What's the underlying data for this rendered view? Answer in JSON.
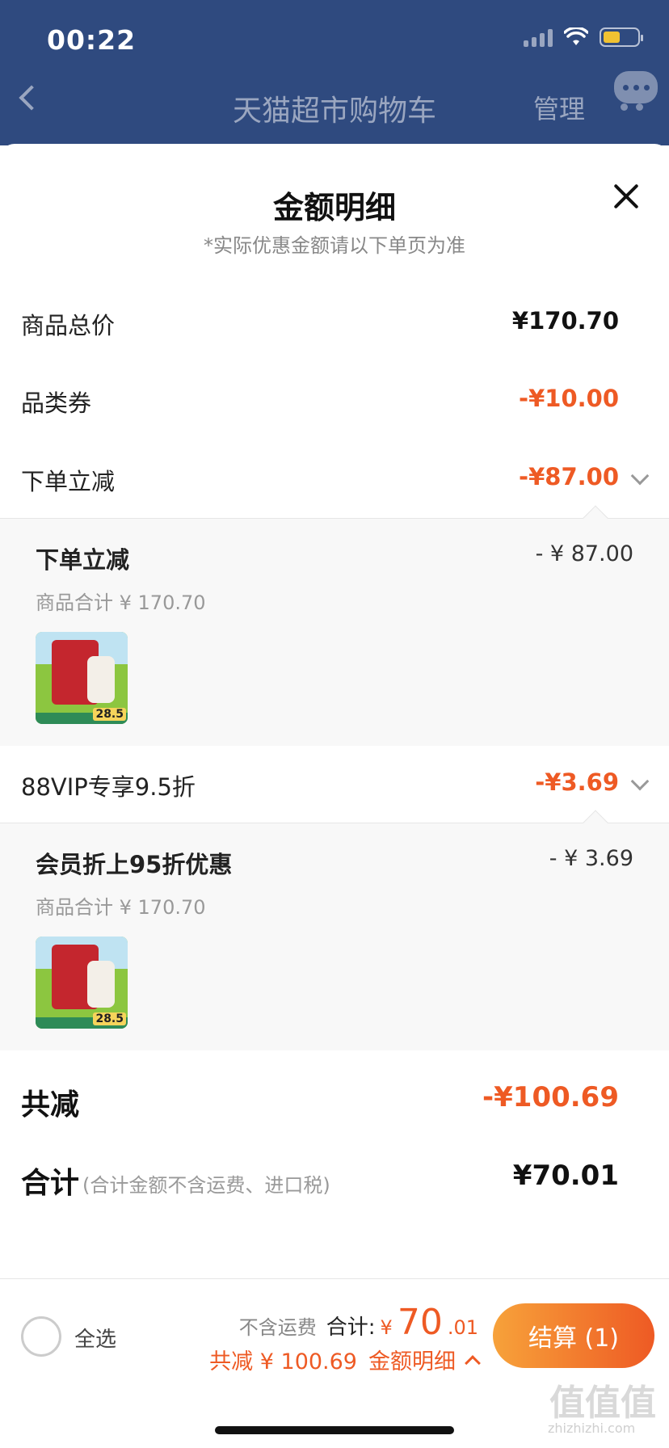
{
  "status": {
    "time": "00:22"
  },
  "nav": {
    "title": "天猫超市购物车",
    "manage": "管理"
  },
  "sheet": {
    "title": "金额明细",
    "subtitle": "*实际优惠金额请以下单页为准",
    "rows": [
      {
        "label": "商品总价",
        "value": "¥170.70"
      },
      {
        "label": "品类券",
        "value": "-¥10.00"
      },
      {
        "label": "下单立减",
        "value": "-¥87.00"
      }
    ],
    "detail1": {
      "title": "下单立减",
      "amount": "- ¥ 87.00",
      "subtotal": "商品合计 ¥ 170.70",
      "thumb_price": "28.5"
    },
    "vip_row": {
      "label": "88VIP专享9.5折",
      "value": "-¥3.69"
    },
    "detail2": {
      "title": "会员折上95折优惠",
      "amount": "- ¥ 3.69",
      "subtotal": "商品合计 ¥ 170.70",
      "thumb_price": "28.5"
    },
    "total_reduce": {
      "label": "共减",
      "value": "-¥100.69"
    },
    "total": {
      "label": "合计",
      "note": "(合计金额不含运费、进口税)",
      "value": "¥70.01"
    }
  },
  "bottom": {
    "select_all": "全选",
    "no_fee": "不含运费",
    "sum_label": "合计:",
    "yen": "¥",
    "sum_int": "70",
    "sum_dec": ".01",
    "reduce_text": "共减 ¥ 100.69",
    "detail_link": "金额明细",
    "checkout": "结算 (1)"
  },
  "watermark": {
    "cn": "值值值",
    "en": "zhizhizhi.com"
  },
  "colors": {
    "accent": "#ee5a24",
    "nav_bg": "#2f4a7f"
  }
}
